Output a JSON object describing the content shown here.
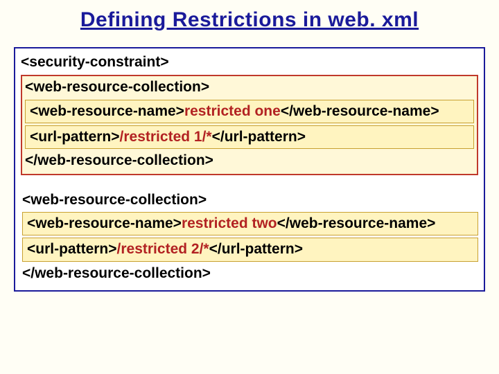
{
  "title": "Defining Restrictions in web. xml",
  "sc_open": "<security-constraint>",
  "block1": {
    "wrc_open": "<web-resource-collection>",
    "name_open": "<web-resource-name>",
    "name_val": "restricted one",
    "name_close": "</web-resource-name>",
    "url_open": "<url-pattern>",
    "url_val": "/restricted 1/*",
    "url_close": "</url-pattern>",
    "wrc_close": "</web-resource-collection>"
  },
  "block2": {
    "wrc_open": "<web-resource-collection>",
    "name_open": "<web-resource-name>",
    "name_val": "restricted two",
    "name_close": "</web-resource-name>",
    "url_open": "<url-pattern>",
    "url_val": "/restricted 2/*",
    "url_close": "</url-pattern>",
    "wrc_close": "</web-resource-collection>"
  }
}
